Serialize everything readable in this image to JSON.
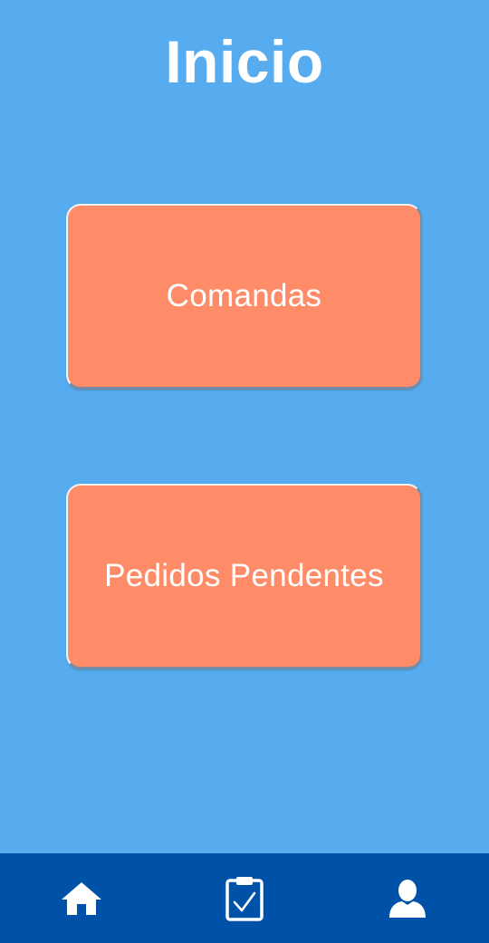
{
  "header": {
    "title": "Inicio"
  },
  "main": {
    "buttons": [
      {
        "label": "Comandas"
      },
      {
        "label": "Pedidos Pendentes"
      }
    ]
  },
  "bottom_nav": {
    "items": [
      {
        "icon": "home-icon"
      },
      {
        "icon": "clipboard-check-icon"
      },
      {
        "icon": "user-icon"
      }
    ]
  },
  "colors": {
    "background": "#56acee",
    "button": "#ff8c69",
    "nav_bar": "#0052a8",
    "text": "#ffffff"
  }
}
